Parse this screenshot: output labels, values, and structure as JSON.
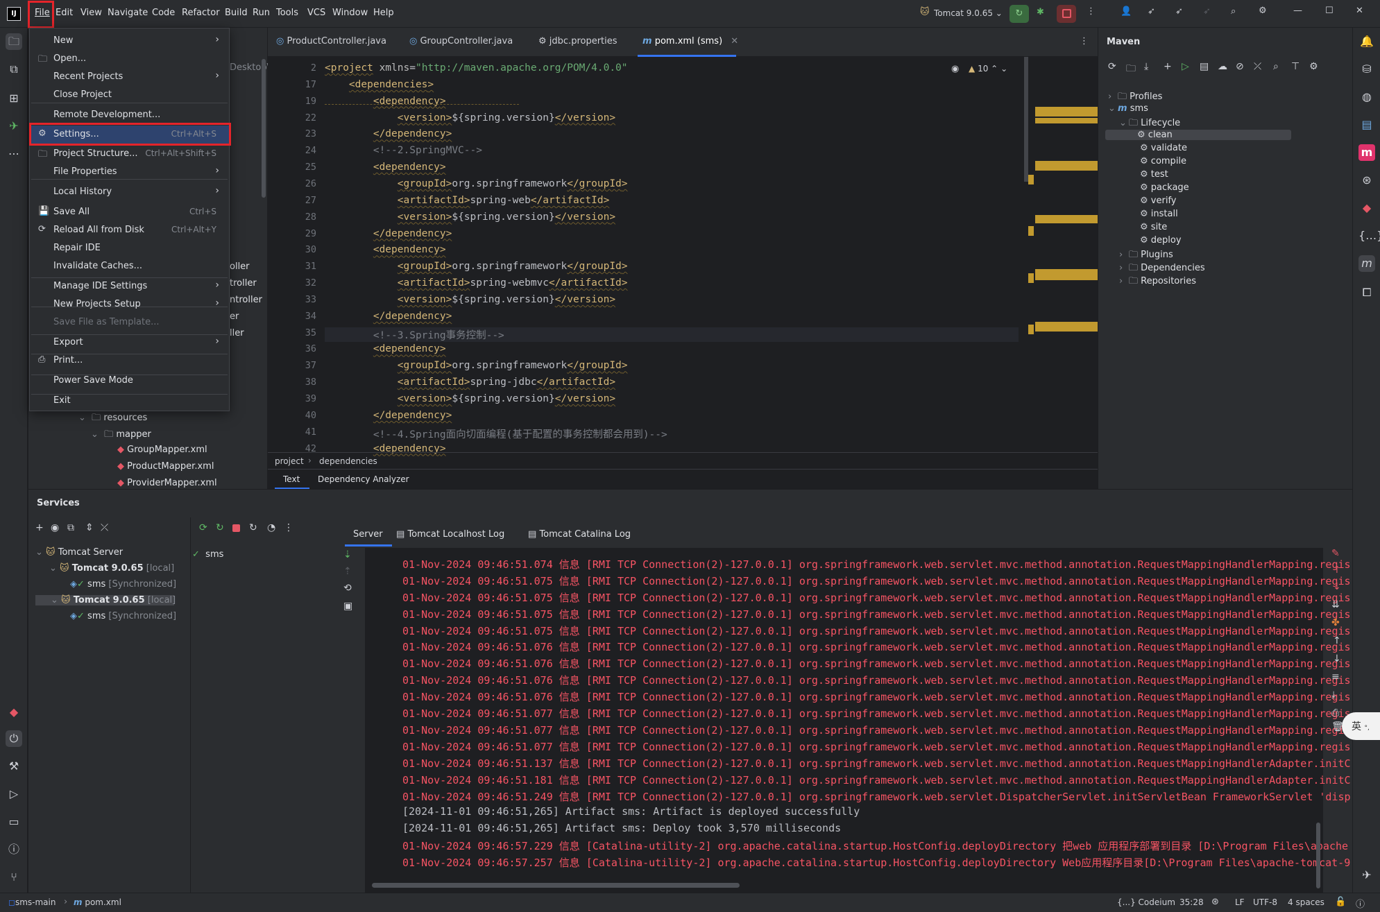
{
  "titlebar": {
    "menus": [
      "File",
      "Edit",
      "View",
      "Navigate",
      "Code",
      "Refactor",
      "Build",
      "Run",
      "Tools",
      "VCS",
      "Window",
      "Help"
    ],
    "run_config": "Tomcat 9.0.65"
  },
  "file_menu": {
    "items": [
      {
        "label": "New",
        "shortcut": "",
        "submenu": true
      },
      {
        "label": "Open...",
        "shortcut": "",
        "submenu": false
      },
      {
        "label": "Recent Projects",
        "shortcut": "",
        "submenu": true
      },
      {
        "label": "Close Project",
        "shortcut": "",
        "submenu": false
      },
      {
        "label": "Remote Development...",
        "shortcut": "",
        "submenu": false
      },
      {
        "label": "Settings...",
        "shortcut": "Ctrl+Alt+S",
        "submenu": false
      },
      {
        "label": "Project Structure...",
        "shortcut": "Ctrl+Alt+Shift+S",
        "submenu": false
      },
      {
        "label": "File Properties",
        "shortcut": "",
        "submenu": true
      },
      {
        "label": "Local History",
        "shortcut": "",
        "submenu": true
      },
      {
        "label": "Save All",
        "shortcut": "Ctrl+S",
        "submenu": false
      },
      {
        "label": "Reload All from Disk",
        "shortcut": "Ctrl+Alt+Y",
        "submenu": false
      },
      {
        "label": "Repair IDE",
        "shortcut": "",
        "submenu": false
      },
      {
        "label": "Invalidate Caches...",
        "shortcut": "",
        "submenu": false
      },
      {
        "label": "Manage IDE Settings",
        "shortcut": "",
        "submenu": true
      },
      {
        "label": "New Projects Setup",
        "shortcut": "",
        "submenu": true
      },
      {
        "label": "Save File as Template...",
        "shortcut": "",
        "submenu": false
      },
      {
        "label": "Export",
        "shortcut": "",
        "submenu": true
      },
      {
        "label": "Print...",
        "shortcut": "",
        "submenu": false
      },
      {
        "label": "Power Save Mode",
        "shortcut": "",
        "submenu": false
      },
      {
        "label": "Exit",
        "shortcut": "",
        "submenu": false
      }
    ]
  },
  "project_tree": {
    "desktop_fragment": "Desktop\\",
    "partials": [
      "oller",
      "troller",
      "ntroller",
      "er",
      "ller"
    ],
    "resources": "resources",
    "mapper": "mapper",
    "files": [
      "GroupMapper.xml",
      "ProductMapper.xml",
      "ProviderMapper.xml"
    ]
  },
  "editor": {
    "tabs": [
      "ProductController.java",
      "GroupController.java",
      "jdbc.properties",
      "pom.xml (sms)"
    ],
    "warnings_count": "10",
    "lines": [
      {
        "n": "2",
        "code": "<project xmlns=\"http://maven.apache.org/POM/4.0.0\""
      },
      {
        "n": "17",
        "code": "    <dependencies>"
      },
      {
        "n": "19",
        "code": "        <dependency>"
      },
      {
        "n": "22",
        "code": "            <version>${spring.version}</version>"
      },
      {
        "n": "23",
        "code": "        </dependency>"
      },
      {
        "n": "24",
        "code": "        <!--2.SpringMVC-->"
      },
      {
        "n": "25",
        "code": "        <dependency>"
      },
      {
        "n": "26",
        "code": "            <groupId>org.springframework</groupId>"
      },
      {
        "n": "27",
        "code": "            <artifactId>spring-web</artifactId>"
      },
      {
        "n": "28",
        "code": "            <version>${spring.version}</version>"
      },
      {
        "n": "29",
        "code": "        </dependency>"
      },
      {
        "n": "30",
        "code": "        <dependency>"
      },
      {
        "n": "31",
        "code": "            <groupId>org.springframework</groupId>"
      },
      {
        "n": "32",
        "code": "            <artifactId>spring-webmvc</artifactId>"
      },
      {
        "n": "33",
        "code": "            <version>${spring.version}</version>"
      },
      {
        "n": "34",
        "code": "        </dependency>"
      },
      {
        "n": "35",
        "code": "        <!--3.Spring事务控制-->"
      },
      {
        "n": "36",
        "code": "        <dependency>"
      },
      {
        "n": "37",
        "code": "            <groupId>org.springframework</groupId>"
      },
      {
        "n": "38",
        "code": "            <artifactId>spring-jdbc</artifactId>"
      },
      {
        "n": "39",
        "code": "            <version>${spring.version}</version>"
      },
      {
        "n": "40",
        "code": "        </dependency>"
      },
      {
        "n": "41",
        "code": "        <!--4.Spring面向切面编程(基于配置的事务控制都会用到)-->"
      },
      {
        "n": "42",
        "code": "        <dependency>"
      }
    ],
    "breadcrumb": [
      "project",
      "dependencies"
    ],
    "bottom_tabs": [
      "Text",
      "Dependency Analyzer"
    ]
  },
  "maven": {
    "title": "Maven",
    "tree": [
      {
        "label": "Profiles",
        "level": 0
      },
      {
        "label": "sms",
        "level": 0
      },
      {
        "label": "Lifecycle",
        "level": 1
      },
      {
        "label": "clean",
        "level": 2
      },
      {
        "label": "validate",
        "level": 2
      },
      {
        "label": "compile",
        "level": 2
      },
      {
        "label": "test",
        "level": 2
      },
      {
        "label": "package",
        "level": 2
      },
      {
        "label": "verify",
        "level": 2
      },
      {
        "label": "install",
        "level": 2
      },
      {
        "label": "site",
        "level": 2
      },
      {
        "label": "deploy",
        "level": 2
      },
      {
        "label": "Plugins",
        "level": 1
      },
      {
        "label": "Dependencies",
        "level": 1
      },
      {
        "label": "Repositories",
        "level": 1
      }
    ]
  },
  "services": {
    "title": "Services",
    "tree": [
      {
        "label": "Tomcat Server",
        "suffix": ""
      },
      {
        "label": "Tomcat 9.0.65",
        "suffix": "[local]"
      },
      {
        "label": "sms",
        "suffix": "[Synchronized]"
      },
      {
        "label": "Tomcat 9.0.65",
        "suffix": "[local]"
      },
      {
        "label": "sms",
        "suffix": "[Synchronized]"
      }
    ],
    "deploy_item": "sms",
    "console_tabs": [
      "Server",
      "Tomcat Localhost Log",
      "Tomcat Catalina Log"
    ],
    "log": [
      {
        "t": "01-Nov-2024 09:46:51.074 信息 [RMI TCP Connection(2)-127.0.0.1] org.springframework.web.servlet.mvc.method.annotation.RequestMappingHandlerMapping.regis",
        "kind": "err"
      },
      {
        "t": "01-Nov-2024 09:46:51.075 信息 [RMI TCP Connection(2)-127.0.0.1] org.springframework.web.servlet.mvc.method.annotation.RequestMappingHandlerMapping.regis",
        "kind": "err"
      },
      {
        "t": "01-Nov-2024 09:46:51.075 信息 [RMI TCP Connection(2)-127.0.0.1] org.springframework.web.servlet.mvc.method.annotation.RequestMappingHandlerMapping.regis",
        "kind": "err"
      },
      {
        "t": "01-Nov-2024 09:46:51.075 信息 [RMI TCP Connection(2)-127.0.0.1] org.springframework.web.servlet.mvc.method.annotation.RequestMappingHandlerMapping.regis",
        "kind": "err"
      },
      {
        "t": "01-Nov-2024 09:46:51.075 信息 [RMI TCP Connection(2)-127.0.0.1] org.springframework.web.servlet.mvc.method.annotation.RequestMappingHandlerMapping.regis",
        "kind": "err"
      },
      {
        "t": "01-Nov-2024 09:46:51.076 信息 [RMI TCP Connection(2)-127.0.0.1] org.springframework.web.servlet.mvc.method.annotation.RequestMappingHandlerMapping.regis",
        "kind": "err"
      },
      {
        "t": "01-Nov-2024 09:46:51.076 信息 [RMI TCP Connection(2)-127.0.0.1] org.springframework.web.servlet.mvc.method.annotation.RequestMappingHandlerMapping.regis",
        "kind": "err"
      },
      {
        "t": "01-Nov-2024 09:46:51.076 信息 [RMI TCP Connection(2)-127.0.0.1] org.springframework.web.servlet.mvc.method.annotation.RequestMappingHandlerMapping.regis",
        "kind": "err"
      },
      {
        "t": "01-Nov-2024 09:46:51.076 信息 [RMI TCP Connection(2)-127.0.0.1] org.springframework.web.servlet.mvc.method.annotation.RequestMappingHandlerMapping.regis",
        "kind": "err"
      },
      {
        "t": "01-Nov-2024 09:46:51.077 信息 [RMI TCP Connection(2)-127.0.0.1] org.springframework.web.servlet.mvc.method.annotation.RequestMappingHandlerMapping.regis",
        "kind": "err"
      },
      {
        "t": "01-Nov-2024 09:46:51.077 信息 [RMI TCP Connection(2)-127.0.0.1] org.springframework.web.servlet.mvc.method.annotation.RequestMappingHandlerMapping.regis",
        "kind": "err"
      },
      {
        "t": "01-Nov-2024 09:46:51.077 信息 [RMI TCP Connection(2)-127.0.0.1] org.springframework.web.servlet.mvc.method.annotation.RequestMappingHandlerMapping.regis",
        "kind": "err"
      },
      {
        "t": "01-Nov-2024 09:46:51.137 信息 [RMI TCP Connection(2)-127.0.0.1] org.springframework.web.servlet.mvc.method.annotation.RequestMappingHandlerAdapter.initC",
        "kind": "err"
      },
      {
        "t": "01-Nov-2024 09:46:51.181 信息 [RMI TCP Connection(2)-127.0.0.1] org.springframework.web.servlet.mvc.method.annotation.RequestMappingHandlerAdapter.initC",
        "kind": "err"
      },
      {
        "t": "01-Nov-2024 09:46:51.249 信息 [RMI TCP Connection(2)-127.0.0.1] org.springframework.web.servlet.DispatcherServlet.initServletBean FrameworkServlet 'disp",
        "kind": "err"
      },
      {
        "t": "[2024-11-01 09:46:51,265] Artifact sms: Artifact is deployed successfully",
        "kind": "info"
      },
      {
        "t": "[2024-11-01 09:46:51,265] Artifact sms: Deploy took 3,570 milliseconds",
        "kind": "info"
      },
      {
        "t": "01-Nov-2024 09:46:57.229 信息 [Catalina-utility-2] org.apache.catalina.startup.HostConfig.deployDirectory 把web 应用程序部署到目录 [D:\\Program Files\\apache",
        "kind": "err"
      },
      {
        "t": "01-Nov-2024 09:46:57.257 信息 [Catalina-utility-2] org.apache.catalina.startup.HostConfig.deployDirectory Web应用程序目录[D:\\Program Files\\apache-tomcat-9",
        "kind": "err"
      }
    ]
  },
  "ime_indicator": "英",
  "statusbar": {
    "branch": "sms-main",
    "file": "pom.xml",
    "codeium": "{...} Codeium",
    "position": "35:28",
    "line_sep": "LF",
    "encoding": "UTF-8",
    "indent": "4 spaces"
  }
}
